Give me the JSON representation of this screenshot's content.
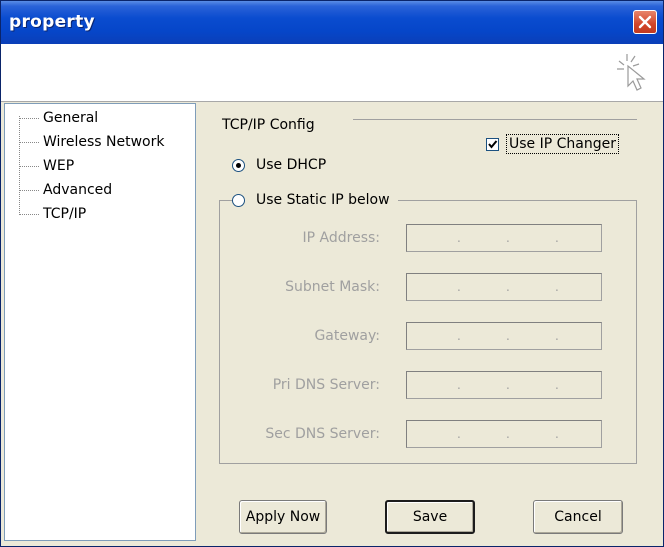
{
  "window": {
    "title": "property"
  },
  "tree": {
    "items": [
      {
        "label": "General"
      },
      {
        "label": "Wireless Network"
      },
      {
        "label": "WEP"
      },
      {
        "label": "Advanced"
      },
      {
        "label": "TCP/IP"
      }
    ]
  },
  "tcpip": {
    "group_title": "TCP/IP Config",
    "use_ip_changer_label": "Use IP Changer",
    "use_ip_changer_checked": true,
    "use_dhcp_label": "Use DHCP",
    "use_dhcp_selected": true,
    "use_static_label": "Use Static IP below",
    "use_static_selected": false,
    "fields": [
      {
        "label": "IP Address:"
      },
      {
        "label": "Subnet Mask:"
      },
      {
        "label": "Gateway:"
      },
      {
        "label": "Pri DNS Server:"
      },
      {
        "label": "Sec DNS Server:"
      }
    ],
    "ip_separator": "."
  },
  "buttons": {
    "apply_label": "Apply Now",
    "save_label": "Save",
    "cancel_label": "Cancel"
  }
}
